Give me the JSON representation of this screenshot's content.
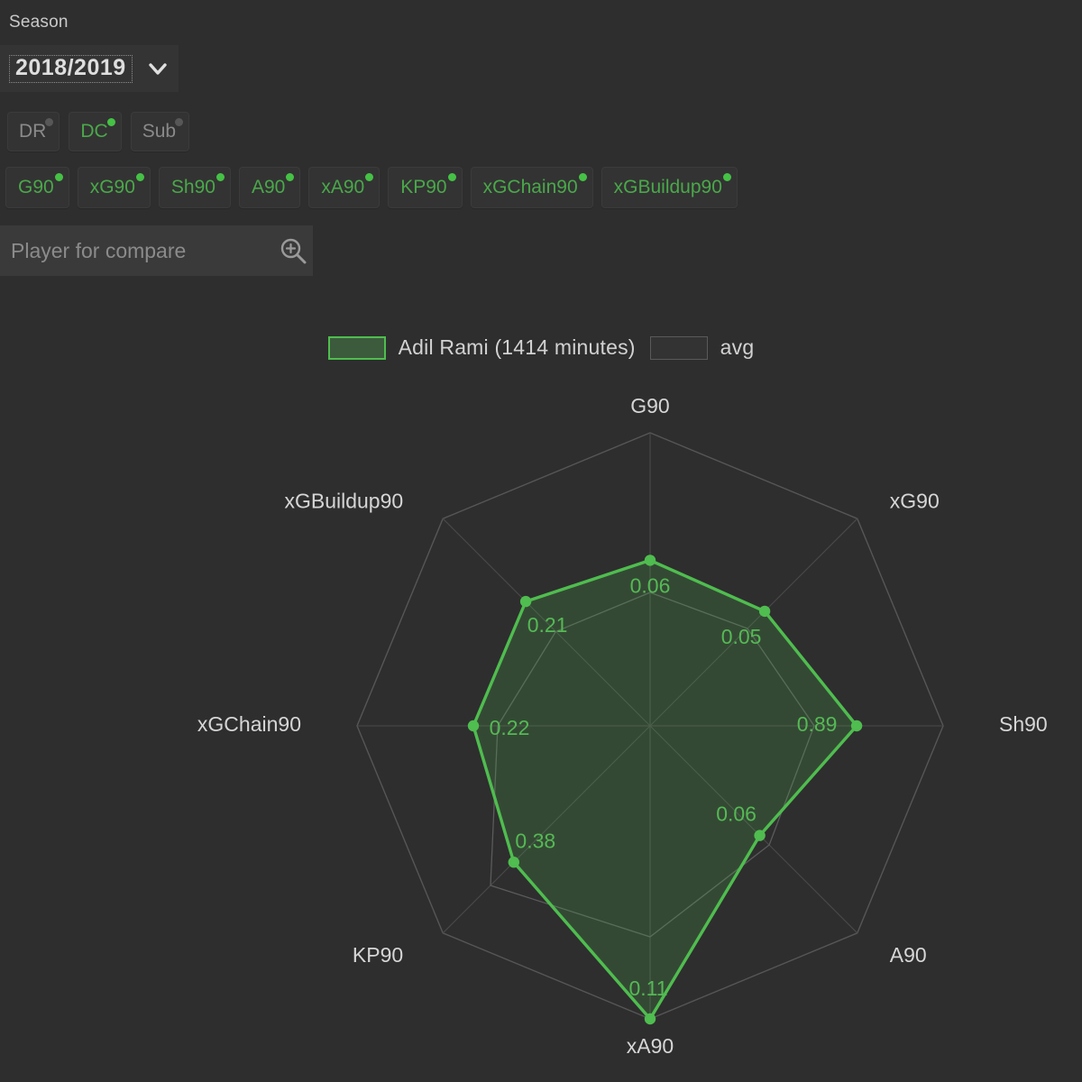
{
  "controls": {
    "season_label": "Season",
    "season_value": "2018/2019",
    "chevron_icon": "chevron-down-icon",
    "position_chips": [
      {
        "label": "DR",
        "active": false
      },
      {
        "label": "DC",
        "active": true
      },
      {
        "label": "Sub",
        "active": false
      }
    ],
    "metric_chips": [
      {
        "label": "G90",
        "active": true
      },
      {
        "label": "xG90",
        "active": true
      },
      {
        "label": "Sh90",
        "active": true
      },
      {
        "label": "A90",
        "active": true
      },
      {
        "label": "xA90",
        "active": true
      },
      {
        "label": "KP90",
        "active": true
      },
      {
        "label": "xGChain90",
        "active": true
      },
      {
        "label": "xGBuildup90",
        "active": true
      }
    ],
    "search": {
      "placeholder": "Player for compare",
      "value": "",
      "icon": "search-zoom-in-icon"
    }
  },
  "legend": {
    "player_label": "Adil Rami (1414 minutes)",
    "avg_label": "avg",
    "player_color": "#4fbd4f",
    "player_fill": "#3c5a3c",
    "avg_color": "#5a5a5a"
  },
  "chart_data": {
    "type": "radar",
    "title": "",
    "legend_position": "top",
    "grid": true,
    "axes": [
      "G90",
      "xG90",
      "Sh90",
      "A90",
      "xA90",
      "KP90",
      "xGChain90",
      "xGBuildup90"
    ],
    "series": [
      {
        "name": "Adil Rami (1414 minutes)",
        "color": "#4fbd4f",
        "values": [
          0.06,
          0.05,
          0.89,
          0.06,
          0.11,
          0.38,
          0.22,
          0.21
        ],
        "value_labels": [
          "0.06",
          "0.05",
          "0.89",
          "0.06",
          "0.11",
          "0.38",
          "0.22",
          "0.21"
        ],
        "normalized": [
          0.565,
          0.553,
          0.705,
          0.529,
          1.0,
          0.658,
          0.603,
          0.6
        ]
      },
      {
        "name": "avg",
        "color": "#5a5a5a",
        "normalized": [
          0.455,
          0.47,
          0.56,
          0.575,
          0.72,
          0.77,
          0.52,
          0.455
        ]
      }
    ]
  }
}
